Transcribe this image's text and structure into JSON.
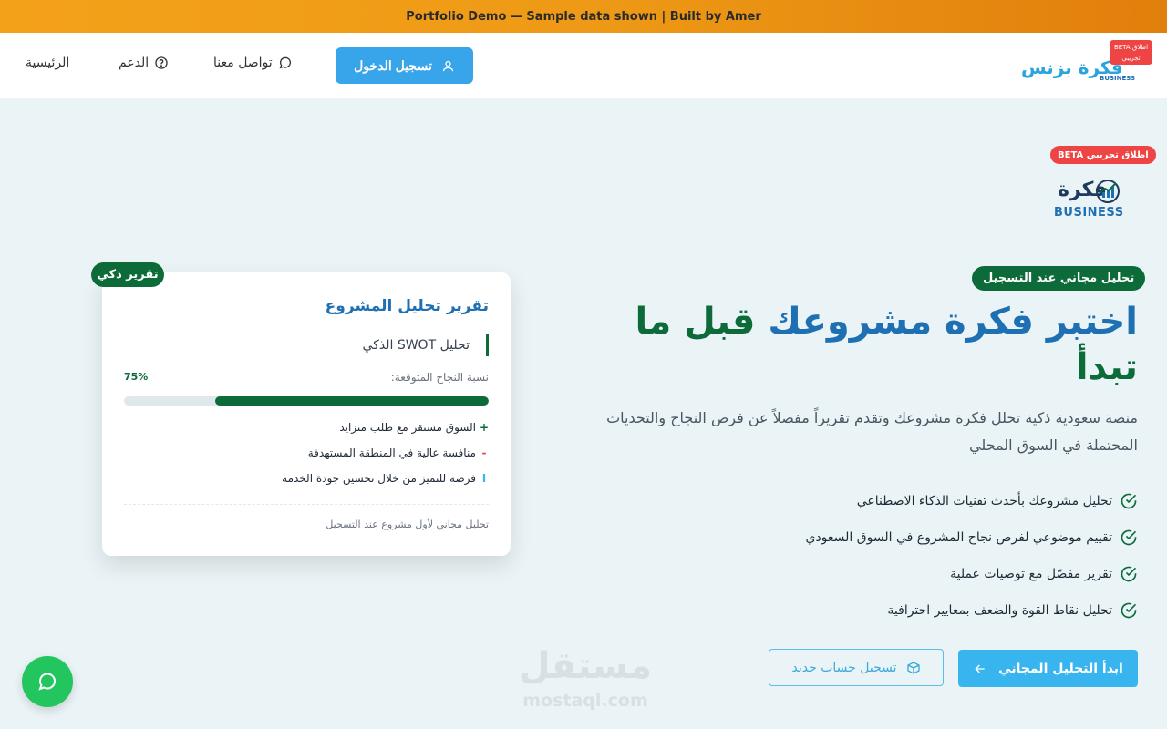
{
  "banner": {
    "text": "Portfolio Demo — Sample data shown | Built by Amer"
  },
  "nav": {
    "home": "الرئيسية",
    "support": "الدعم",
    "contact": "تواصل معنا",
    "login": "تسجيل الدخول",
    "logo_text": "فكرة بزنس",
    "logo_sub": "BUSINESS",
    "beta_badge": "BETA اطلاق تجريبي"
  },
  "hero": {
    "beta_badge": "BETA اطلاق تجريبي",
    "logo_text": "فكرة",
    "logo_sub": "BUSINESS",
    "free_badge": "تحليل مجاني عند التسجيل",
    "headline_part1": "اختبر فكرة مشروعك",
    "headline_part2": "قبل ما تبدأ",
    "subtitle": "منصة سعودية ذكية تحلل فكرة مشروعك وتقدم تقريراً مفصلاً عن فرص النجاح والتحديات المحتملة في السوق المحلي",
    "features": [
      "تحليل مشروعك بأحدث تقنيات الذكاء الاصطناعي",
      "تقييم موضوعي لفرص نجاح المشروع في السوق السعودي",
      "تقرير مفصّل مع توصيات عملية",
      "تحليل نقاط القوة والضعف بمعايير احترافية"
    ],
    "start_button": "ابدأ التحليل المجاني",
    "register_button": "تسجيل حساب جديد"
  },
  "report": {
    "badge": "تقرير ذكي",
    "title": "تقرير تحليل المشروع",
    "swot_label": "تحليل SWOT الذكي",
    "rate_label": "نسبة النجاح المتوقعة:",
    "rate_value": "75%",
    "rate_fraction": 0.75,
    "items": [
      {
        "marker": "+",
        "text": "السوق مستقر مع طلب متزايد"
      },
      {
        "marker": "-",
        "text": "منافسة عالية في المنطقة المستهدفة"
      },
      {
        "marker": "I",
        "text": "فرصة للتميز من خلال تحسين جودة الخدمة"
      }
    ],
    "footer": "تحليل مجاني لأول مشروع عند التسجيل"
  },
  "watermark": {
    "arabic": "مستقل",
    "latin": "mostaql.com"
  },
  "colors": {
    "brand_green": "#0d6b3a",
    "brand_blue": "#1f6fb3",
    "accent_sky": "#38b5ef",
    "beta_red": "#ef4444",
    "chat_green": "#22c55e"
  },
  "icons": {
    "login": "user-icon",
    "support": "help-circle-icon",
    "contact": "message-bubble-icon",
    "feature": "check-circle-icon",
    "start": "arrow-left-icon",
    "register": "cube-icon",
    "chat": "chat-icon"
  }
}
